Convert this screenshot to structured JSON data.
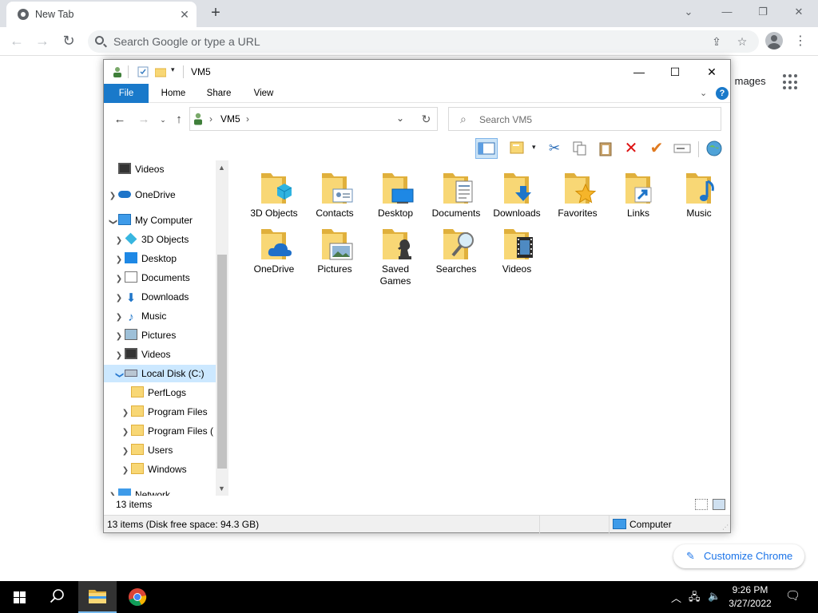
{
  "browser": {
    "tab_title": "New Tab",
    "new_tab_symbol": "+",
    "omnibox_placeholder": "Search Google or type a URL",
    "page_images_link": "Images",
    "customize_label": "Customize Chrome"
  },
  "explorer": {
    "window_title": "VM5",
    "ribbon_tabs": [
      "File",
      "Home",
      "Share",
      "View"
    ],
    "breadcrumb": "VM5",
    "search_placeholder": "Search VM5",
    "nav_items": [
      {
        "label": "Videos"
      },
      {
        "label": "OneDrive"
      },
      {
        "label": "My Computer"
      },
      {
        "label": "3D Objects"
      },
      {
        "label": "Desktop"
      },
      {
        "label": "Documents"
      },
      {
        "label": "Downloads"
      },
      {
        "label": "Music"
      },
      {
        "label": "Pictures"
      },
      {
        "label": "Videos"
      },
      {
        "label": "Local Disk (C:)"
      },
      {
        "label": "PerfLogs"
      },
      {
        "label": "Program Files"
      },
      {
        "label": "Program Files ("
      },
      {
        "label": "Users"
      },
      {
        "label": "Windows"
      },
      {
        "label": "Network"
      }
    ],
    "folders": [
      {
        "label": "3D Objects",
        "overlay": "cube"
      },
      {
        "label": "Contacts",
        "overlay": "contact-card"
      },
      {
        "label": "Desktop",
        "overlay": "monitor"
      },
      {
        "label": "Documents",
        "overlay": "document"
      },
      {
        "label": "Downloads",
        "overlay": "down-arrow"
      },
      {
        "label": "Favorites",
        "overlay": "star"
      },
      {
        "label": "Links",
        "overlay": "link-arrow"
      },
      {
        "label": "Music",
        "overlay": "music-note"
      },
      {
        "label": "OneDrive",
        "overlay": "cloud"
      },
      {
        "label": "Pictures",
        "overlay": "picture"
      },
      {
        "label": "Saved Games",
        "overlay": "chess-piece"
      },
      {
        "label": "Searches",
        "overlay": "magnifier"
      },
      {
        "label": "Videos",
        "overlay": "film"
      }
    ],
    "item_count": "13 items",
    "status_left": "13 items (Disk free space: 94.3 GB)",
    "status_right": "Computer"
  },
  "taskbar": {
    "time": "9:26 PM",
    "date": "3/27/2022"
  },
  "colors": {
    "folder_yellow": "#f8d775",
    "folder_dark": "#e0b03c",
    "explorer_accent": "#1979ca",
    "selection": "#cce8ff",
    "chrome_link": "#1a73e8"
  }
}
